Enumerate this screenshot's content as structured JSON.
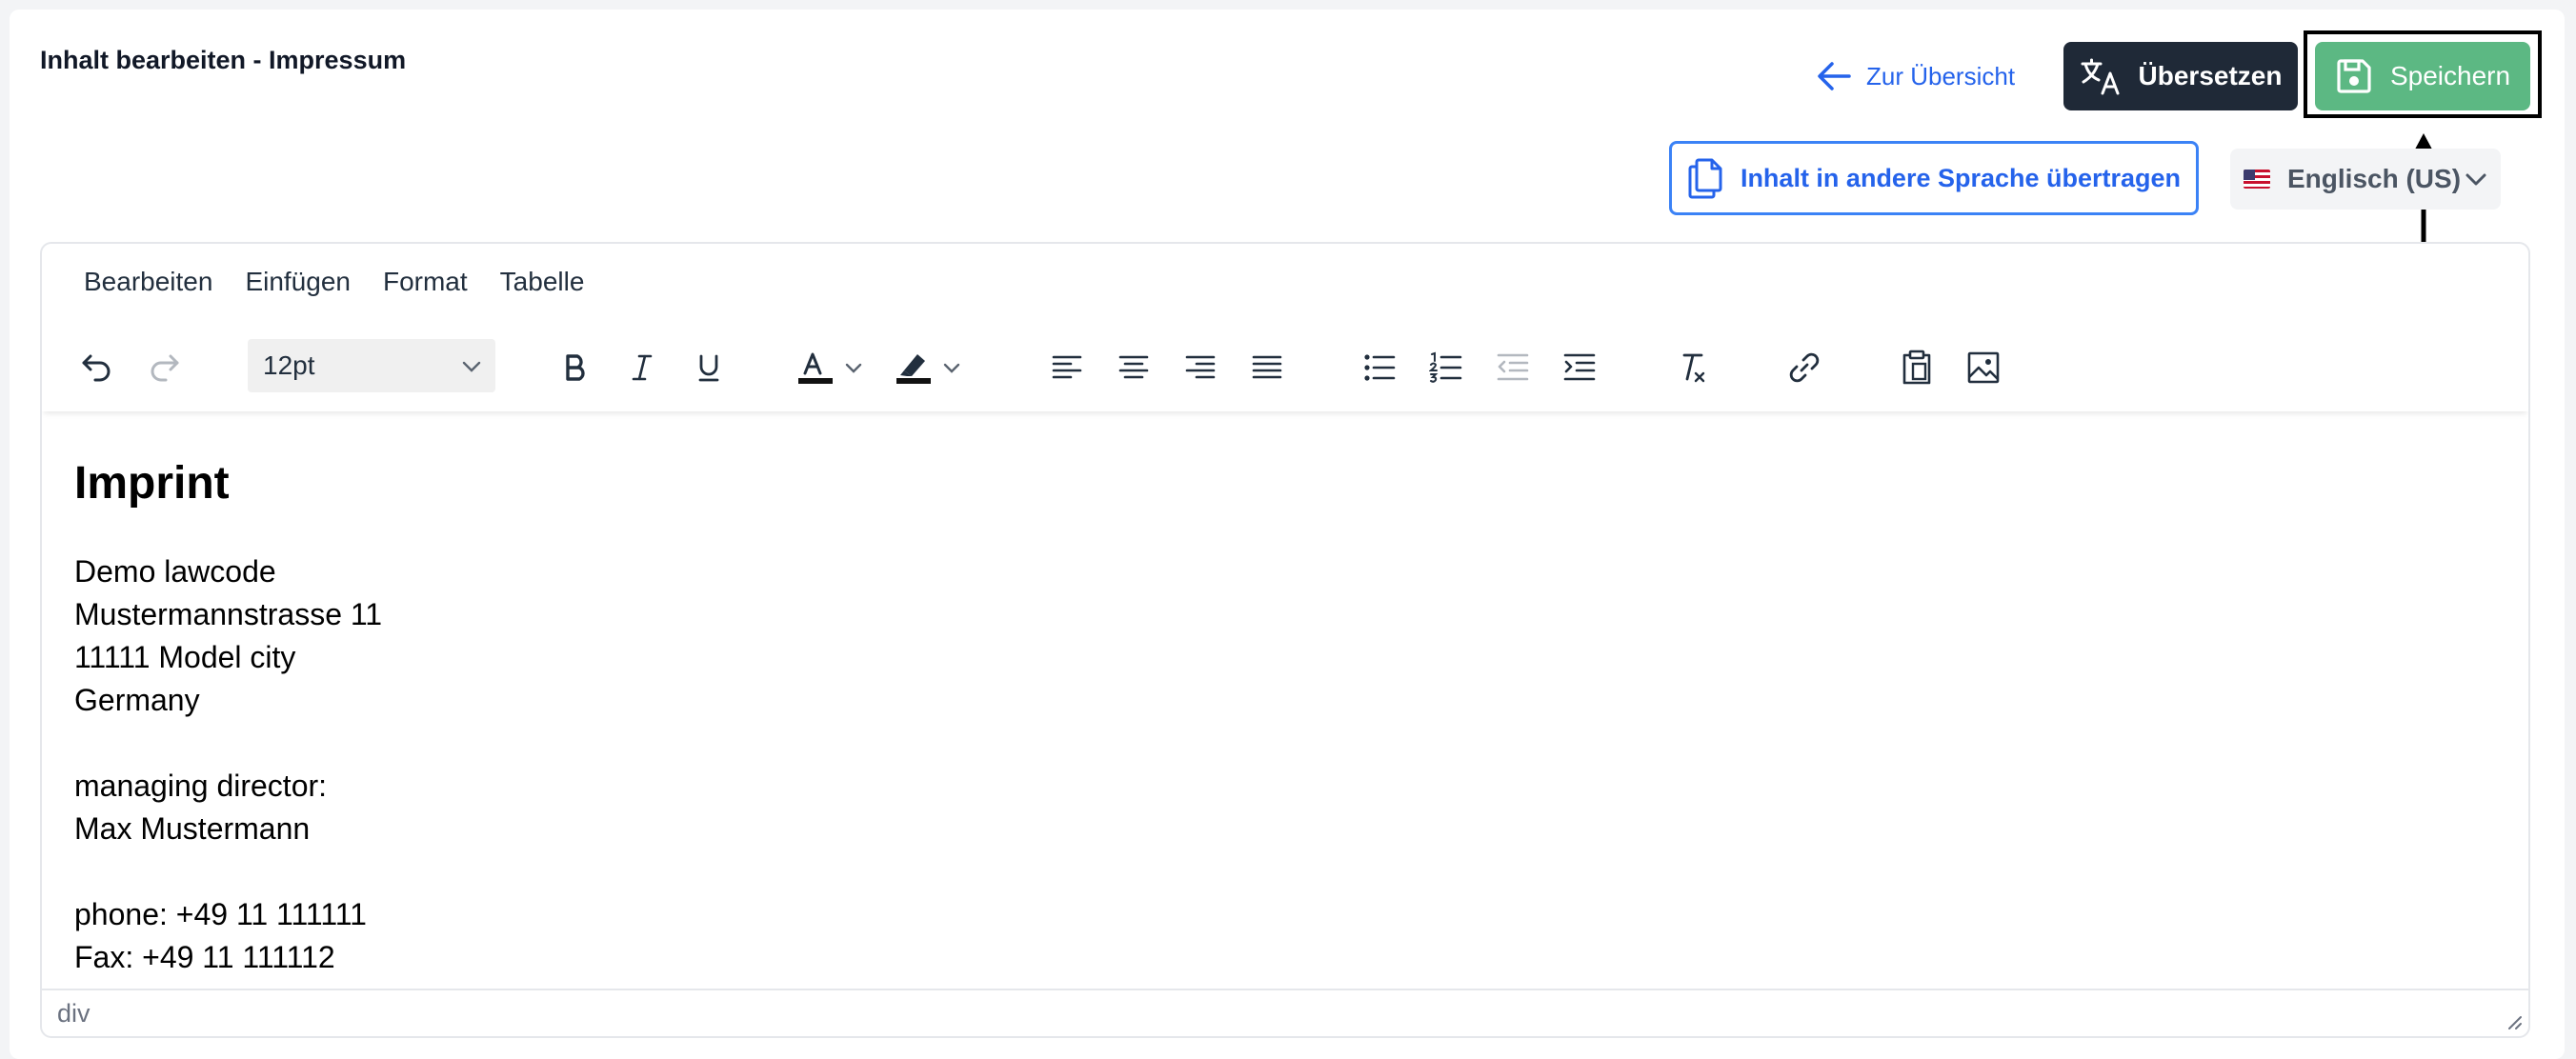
{
  "header": {
    "title": "Inhalt bearbeiten - Impressum",
    "back_label": "Zur Übersicht",
    "translate_label": "Übersetzen",
    "save_label": "Speichern",
    "transfer_label": "Inhalt in andere Sprache übertragen",
    "language": "Englisch (US)"
  },
  "editor": {
    "menu": [
      "Bearbeiten",
      "Einfügen",
      "Format",
      "Tabelle"
    ],
    "font_size": "12pt",
    "content": {
      "heading": "Imprint",
      "lines": [
        "Demo lawcode",
        "Mustermannstrasse 11",
        "11111 Model city",
        "Germany",
        "",
        "managing director:",
        "Max Mustermann",
        "",
        "phone: +49 11 111111",
        "Fax: +49 11 111112"
      ]
    },
    "status_path": "div"
  },
  "colors": {
    "link_blue": "#2563eb",
    "dark_button": "#1f2937",
    "save_green": "#5cb883",
    "toolbar_icon": "#222f3e"
  }
}
